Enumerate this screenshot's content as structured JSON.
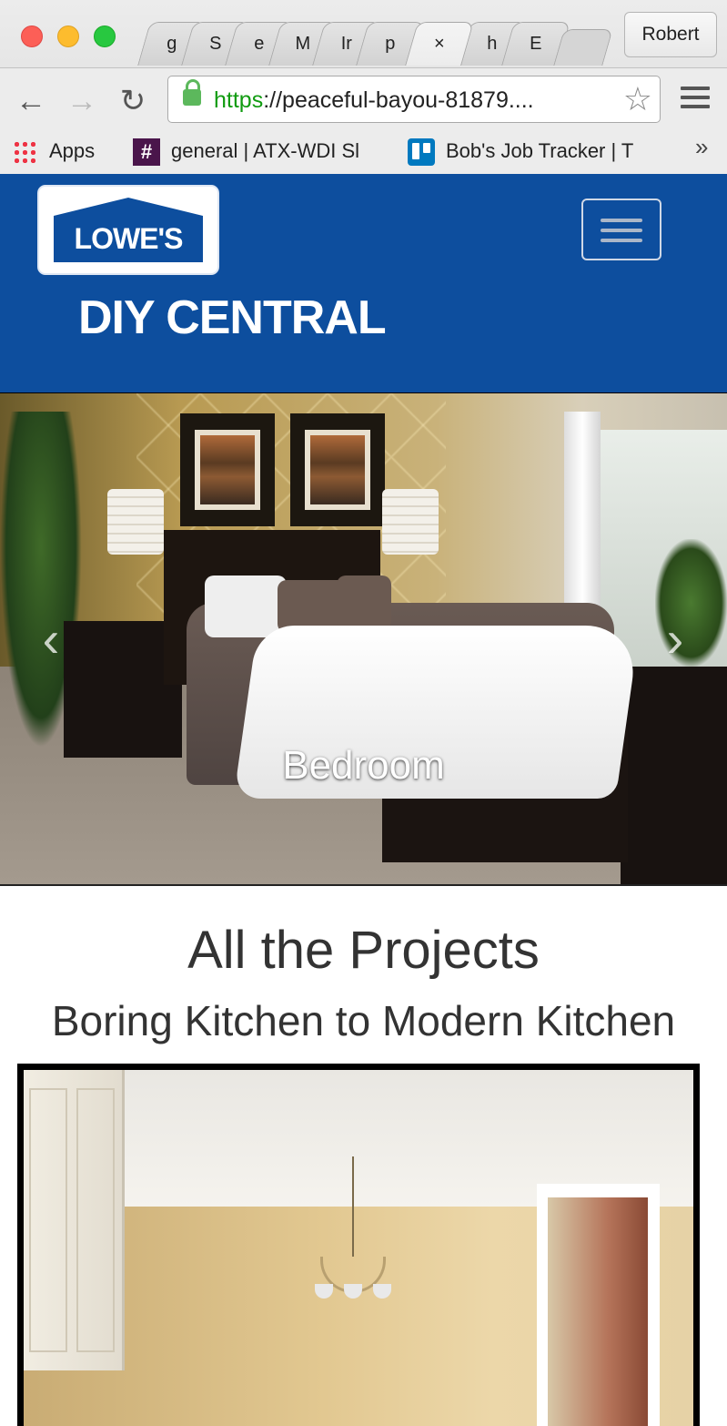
{
  "browser": {
    "tabs": [
      "g",
      "S",
      "e",
      "M",
      "Ir",
      "p",
      "×",
      "h",
      "E"
    ],
    "profile_label": "Robert",
    "url_scheme": "https",
    "url_rest": "://peaceful-bayou-81879....",
    "bookmarks": {
      "apps": "Apps",
      "slack": "general | ATX-WDI Sl",
      "slack_icon_glyph": "#",
      "trello": "Bob's Job Tracker | T",
      "more": "»"
    },
    "icons": {
      "back": "back-arrow-icon",
      "forward": "forward-arrow-icon",
      "reload": "reload-icon",
      "lock": "lock-icon",
      "star": "star-icon",
      "menu": "hamburger-menu-icon"
    }
  },
  "site": {
    "logo_text": "LOWE'S",
    "title": "DIY CENTRAL",
    "brand_color": "#0d4e9e"
  },
  "carousel": {
    "caption": "Bedroom",
    "prev_glyph": "‹",
    "next_glyph": "›"
  },
  "projects": {
    "heading": "All the Projects",
    "items": [
      {
        "title": "Boring Kitchen to Modern Kitchen"
      }
    ]
  }
}
